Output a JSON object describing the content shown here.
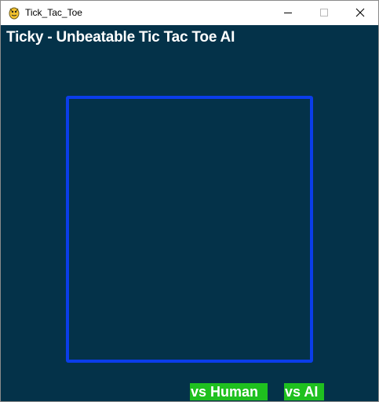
{
  "window": {
    "title": "Tick_Tac_Toe",
    "icon": "pygame-snake-icon"
  },
  "game": {
    "title": "Ticky - Unbeatable Tic Tac Toe AI",
    "background_color": "#043249",
    "board_border_color": "#0b3dea",
    "buttons": {
      "vs_human": "vs Human",
      "vs_ai": "vs AI",
      "button_color": "#1fc01f"
    }
  }
}
